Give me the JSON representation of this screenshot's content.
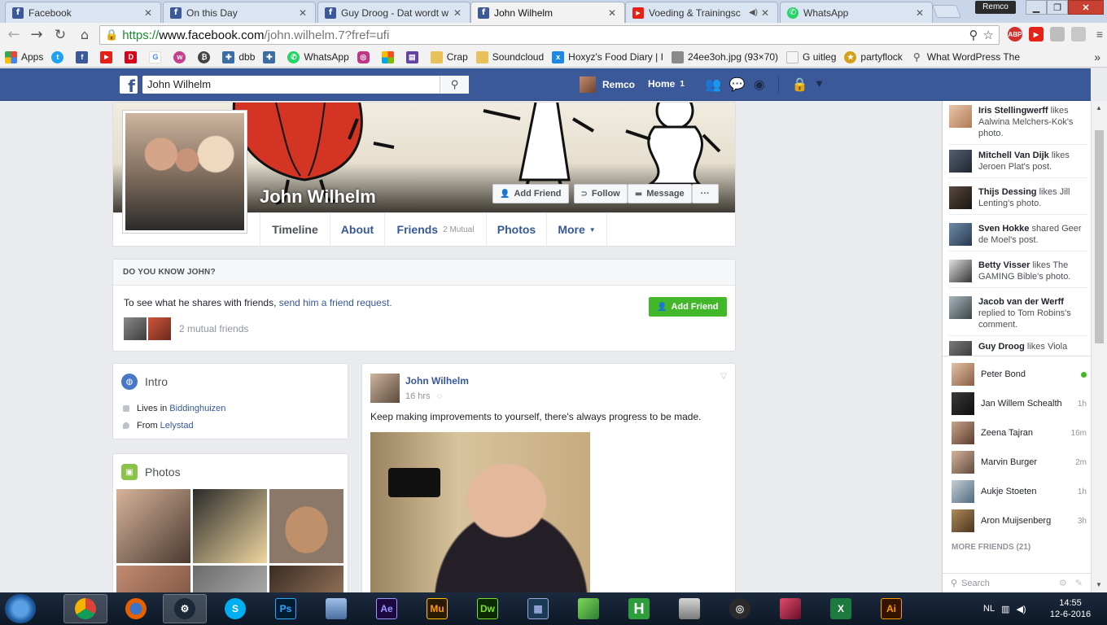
{
  "browser": {
    "tabs": [
      {
        "label": "Facebook",
        "icon": "facebook-icon",
        "color": "#3b5998",
        "glyph": "f"
      },
      {
        "label": "On this Day",
        "icon": "facebook-icon",
        "color": "#3b5998",
        "glyph": "f"
      },
      {
        "label": "Guy Droog - Dat wordt w",
        "icon": "facebook-icon",
        "color": "#3b5998",
        "glyph": "f"
      },
      {
        "label": "John Wilhelm",
        "icon": "facebook-icon",
        "color": "#3b5998",
        "glyph": "f",
        "active": true
      },
      {
        "label": "Voeding & Trainingsc",
        "icon": "youtube-icon",
        "color": "#e62117",
        "glyph": "▶",
        "muted": true
      },
      {
        "label": "WhatsApp",
        "icon": "whatsapp-icon",
        "color": "#25d366",
        "glyph": "✆"
      }
    ],
    "profile_name": "Remco",
    "url": {
      "scheme": "https://",
      "host": "www.facebook.com",
      "path": "/john.wilhelm.7?fref=ufi"
    },
    "bookmarks": [
      {
        "label": "Apps",
        "icon": "apps-grid-icon",
        "color": "#e8453c"
      },
      {
        "label": "",
        "icon": "twitter-icon",
        "color": "#1da1f2"
      },
      {
        "label": "",
        "icon": "facebook-icon",
        "color": "#3b5998"
      },
      {
        "label": "",
        "icon": "youtube-icon",
        "color": "#e62117"
      },
      {
        "label": "",
        "icon": "dumpert-icon",
        "color": "#d9001b"
      },
      {
        "label": "",
        "icon": "google-icon",
        "color": "#4285f4"
      },
      {
        "label": "",
        "icon": "wordpress-icon",
        "color": "#c73f8c"
      },
      {
        "label": "",
        "icon": "bitcoin-icon",
        "color": "#444444"
      },
      {
        "label": "dbb",
        "icon": "puzzle-icon",
        "color": "#3b6ea5"
      },
      {
        "label": "",
        "icon": "puzzle-icon",
        "color": "#3b6ea5"
      },
      {
        "label": "WhatsApp",
        "icon": "whatsapp-icon",
        "color": "#25d366"
      },
      {
        "label": "",
        "icon": "instagram-icon",
        "color": "#c13584"
      },
      {
        "label": "",
        "icon": "windows-icon",
        "color": "#f25022"
      },
      {
        "label": "",
        "icon": "twitch-icon",
        "color": "#6441a5"
      },
      {
        "label": "Crap",
        "icon": "folder-icon",
        "color": "#e8c15a"
      },
      {
        "label": "Soundcloud",
        "icon": "folder-icon",
        "color": "#e8c15a"
      },
      {
        "label": "Hoxyz's Food Diary | I",
        "icon": "hoxyz-icon",
        "color": "#1e88e5"
      },
      {
        "label": "24ee3oh.jpg (93×70)",
        "icon": "image-icon",
        "color": "#8a8a8a"
      },
      {
        "label": "G uitleg",
        "icon": "page-icon",
        "color": "#bdbdbd"
      },
      {
        "label": "partyflock",
        "icon": "partyflock-icon",
        "color": "#d4a017"
      },
      {
        "label": "What WordPress The",
        "icon": "search-icon",
        "color": "#777777"
      }
    ]
  },
  "facebook": {
    "search_value": "John Wilhelm",
    "user_name": "Remco",
    "home_label": "Home",
    "home_count": "1"
  },
  "profile": {
    "name": "John Wilhelm",
    "buttons": {
      "add_friend": "Add Friend",
      "follow": "Follow",
      "message": "Message",
      "more": "···"
    },
    "tabs": {
      "timeline": "Timeline",
      "about": "About",
      "friends": "Friends",
      "friends_mutual": "2 Mutual",
      "photos": "Photos",
      "more": "More"
    },
    "know_box": {
      "heading": "DO YOU KNOW JOHN?",
      "text": "To see what he shares with friends,",
      "link": "send him a friend request.",
      "mutual": "2 mutual friends",
      "button": "Add Friend"
    },
    "intro": {
      "title": "Intro",
      "lives_prefix": "Lives in",
      "lives_place": "Biddinghuizen",
      "from_prefix": "From",
      "from_place": "Lelystad"
    },
    "photos_title": "Photos",
    "post": {
      "author": "John Wilhelm",
      "time": "16 hrs",
      "text": "Keep making improvements to yourself, there's always progress to be made."
    }
  },
  "ticker": [
    {
      "name": "Iris Stellingwerff",
      "rest": "likes Aalwina Melchers-Kok's photo."
    },
    {
      "name": "Mitchell Van Dijk",
      "rest": "likes Jeroen Plat's post."
    },
    {
      "name": "Thijs Dessing",
      "rest": "likes Jill Lenting's photo."
    },
    {
      "name": "Sven Hokke",
      "rest": "shared Geer de Moel's post."
    },
    {
      "name": "Betty Visser",
      "rest": "likes The GAMING Bible's photo."
    },
    {
      "name": "Jacob van der Werff",
      "rest": "replied to Tom Robins's comment."
    },
    {
      "name": "Guy Droog",
      "rest": "likes Viola"
    }
  ],
  "chat": [
    {
      "name": "Peter Bond",
      "status": "online"
    },
    {
      "name": "Jan Willem Schealth",
      "status": "1h"
    },
    {
      "name": "Zeena Tajran",
      "status": "16m"
    },
    {
      "name": "Marvin Burger",
      "status": "2m"
    },
    {
      "name": "Aukje Stoeten",
      "status": "1h"
    },
    {
      "name": "Aron Muijsenberg",
      "status": "3h"
    }
  ],
  "more_friends": "MORE FRIENDS (21)",
  "chat_search_placeholder": "Search",
  "taskbar": {
    "apps": [
      {
        "name": "chrome",
        "glyph": "",
        "color": "#db4437",
        "active": true
      },
      {
        "name": "firefox",
        "glyph": "",
        "color": "#e66000"
      },
      {
        "name": "steam",
        "glyph": "",
        "color": "#1b2838",
        "active": true
      },
      {
        "name": "skype",
        "glyph": "S",
        "color": "#00aff0"
      },
      {
        "name": "photoshop",
        "glyph": "Ps",
        "color": "#001d34"
      },
      {
        "name": "explorer",
        "glyph": "",
        "color": "#6d8fbf"
      },
      {
        "name": "after-effects",
        "glyph": "Ae",
        "color": "#1f0740"
      },
      {
        "name": "muse",
        "glyph": "Mu",
        "color": "#2b1a06"
      },
      {
        "name": "dreamweaver",
        "glyph": "Dw",
        "color": "#0c2a05"
      },
      {
        "name": "video-editor",
        "glyph": "",
        "color": "#1b3a55"
      },
      {
        "name": "notepad-plus",
        "glyph": "",
        "color": "#5cae3b"
      },
      {
        "name": "h-app",
        "glyph": "H",
        "color": "#2e9d3c"
      },
      {
        "name": "monitor-app",
        "glyph": "",
        "color": "#8a8a8a"
      },
      {
        "name": "gpu-app",
        "glyph": "",
        "color": "#2b2b2b"
      },
      {
        "name": "game-app",
        "glyph": "",
        "color": "#b22a4a"
      },
      {
        "name": "excel",
        "glyph": "X",
        "color": "#1d7a3e"
      },
      {
        "name": "illustrator",
        "glyph": "Ai",
        "color": "#331400"
      }
    ],
    "language": "NL",
    "time": "14:55",
    "date": "12-6-2016"
  }
}
